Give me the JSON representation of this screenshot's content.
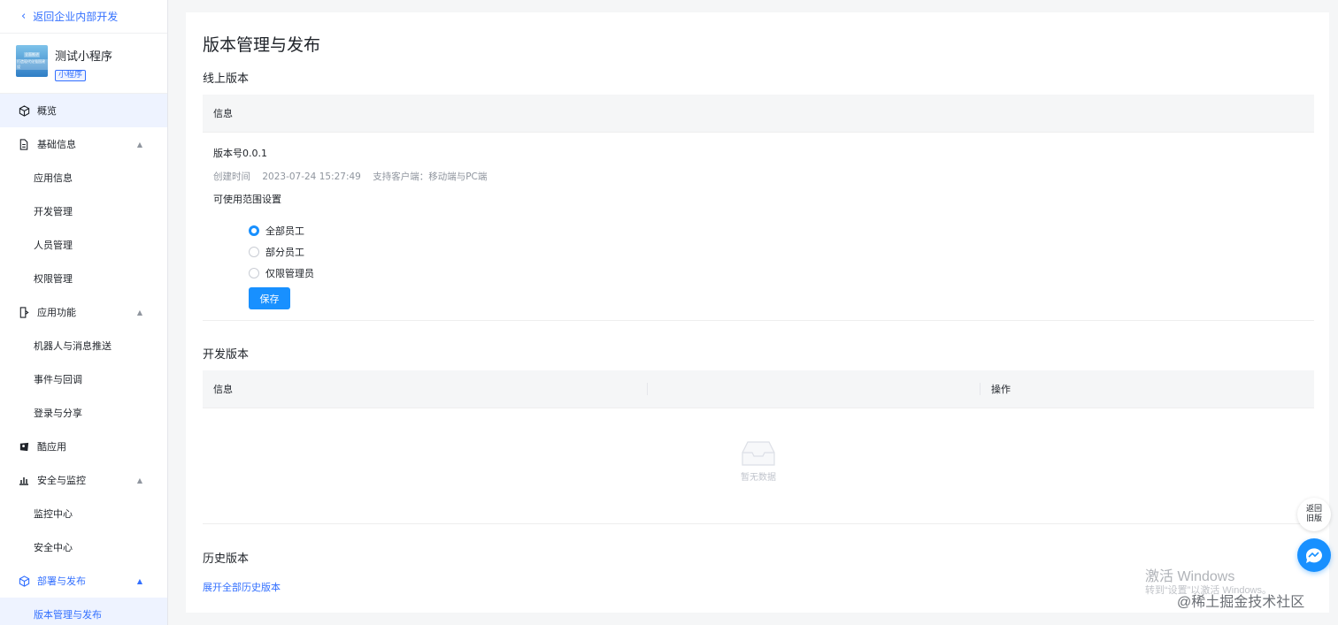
{
  "sidebar": {
    "back_label": "返回企业内部开发",
    "app_name": "测试小程序",
    "app_tag": "小程序",
    "logo_text": [
      "全面推进",
      "打造现代化强国建设"
    ],
    "items": [
      {
        "label": "概览",
        "icon": "cube-icon",
        "type": "top",
        "active": true
      },
      {
        "label": "基础信息",
        "icon": "document-icon",
        "type": "group",
        "expanded": true
      },
      {
        "label": "应用信息",
        "type": "sub"
      },
      {
        "label": "开发管理",
        "type": "sub"
      },
      {
        "label": "人员管理",
        "type": "sub"
      },
      {
        "label": "权限管理",
        "type": "sub"
      },
      {
        "label": "应用功能",
        "icon": "app-function-icon",
        "type": "group",
        "expanded": true
      },
      {
        "label": "机器人与消息推送",
        "type": "sub"
      },
      {
        "label": "事件与回调",
        "type": "sub"
      },
      {
        "label": "登录与分享",
        "type": "sub"
      },
      {
        "label": "酷应用",
        "icon": "cool-app-icon",
        "type": "top"
      },
      {
        "label": "安全与监控",
        "icon": "bar-chart-icon",
        "type": "group",
        "expanded": true
      },
      {
        "label": "监控中心",
        "type": "sub"
      },
      {
        "label": "安全中心",
        "type": "sub"
      },
      {
        "label": "部署与发布",
        "icon": "cube-icon",
        "type": "group",
        "expanded": true,
        "highlight": true
      },
      {
        "label": "版本管理与发布",
        "type": "sub",
        "active": true
      }
    ]
  },
  "main": {
    "title": "版本管理与发布",
    "online": {
      "heading": "线上版本",
      "header_info": "信息",
      "version": "版本号0.0.1",
      "created_label": "创建时间",
      "created_at": "2023-07-24 15:27:49",
      "clients": "支持客户端：移动端与PC端",
      "scope_label": "可使用范围设置",
      "options": [
        {
          "label": "全部员工",
          "checked": true
        },
        {
          "label": "部分员工",
          "checked": false
        },
        {
          "label": "仅限管理员",
          "checked": false
        }
      ],
      "save_label": "保存"
    },
    "dev": {
      "heading": "开发版本",
      "header_info": "信息",
      "header_op": "操作",
      "empty_text": "暂无数据"
    },
    "history": {
      "heading": "历史版本",
      "expand_link": "展开全部历史版本"
    }
  },
  "float": {
    "back_old": "返回旧版"
  },
  "overlay": {
    "activate_title": "激活 Windows",
    "activate_sub": "转到“设置”以激活 Windows。",
    "watermark": "@稀土掘金技术社区"
  },
  "colors": {
    "accent": "#1890ff",
    "link": "#3370ff"
  }
}
